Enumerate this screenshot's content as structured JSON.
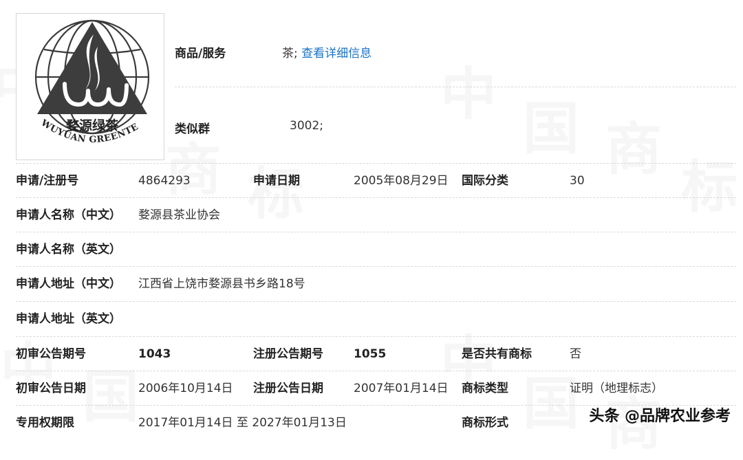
{
  "logo": {
    "name": "trademark-logo",
    "chinese_text": "婺源绿茶",
    "english_text": "WUYUAN GREENTEA"
  },
  "goods": {
    "label": "商品/服务",
    "value_prefix": "茶; ",
    "link_text": "查看详细信息"
  },
  "similar_group": {
    "label": "类似群",
    "value": "3002;"
  },
  "rows": [
    {
      "l1": "申请/注册号",
      "v1": "4864293",
      "l2": "申请日期",
      "v2": "2005年08月29日",
      "l3": "国际分类",
      "v3": "30"
    },
    {
      "l1": "申请人名称（中文）",
      "v1": "婺源县茶业协会"
    },
    {
      "l1": "申请人名称（英文）",
      "v1": ""
    },
    {
      "l1": "申请人地址（中文）",
      "v1": "江西省上饶市婺源县书乡路18号"
    },
    {
      "l1": "申请人地址（英文）",
      "v1": ""
    },
    {
      "l1": "初审公告期号",
      "v1": "1043",
      "l2": "注册公告期号",
      "v2": "1055",
      "l3": "是否共有商标",
      "v3": "否"
    },
    {
      "l1": "初审公告日期",
      "v1": "2006年10月14日",
      "l2": "注册公告日期",
      "v2": "2007年01月14日",
      "l3": "商标类型",
      "v3": "证明（地理标志）"
    },
    {
      "l1": "专用权期限",
      "v1": "2017年01月14日 至 2027年01月13日",
      "l3": "商标形式",
      "v3": ""
    }
  ],
  "watermark": {
    "chars": [
      "中",
      "国",
      "商",
      "标"
    ]
  },
  "credit": "头条 @品牌农业参考"
}
